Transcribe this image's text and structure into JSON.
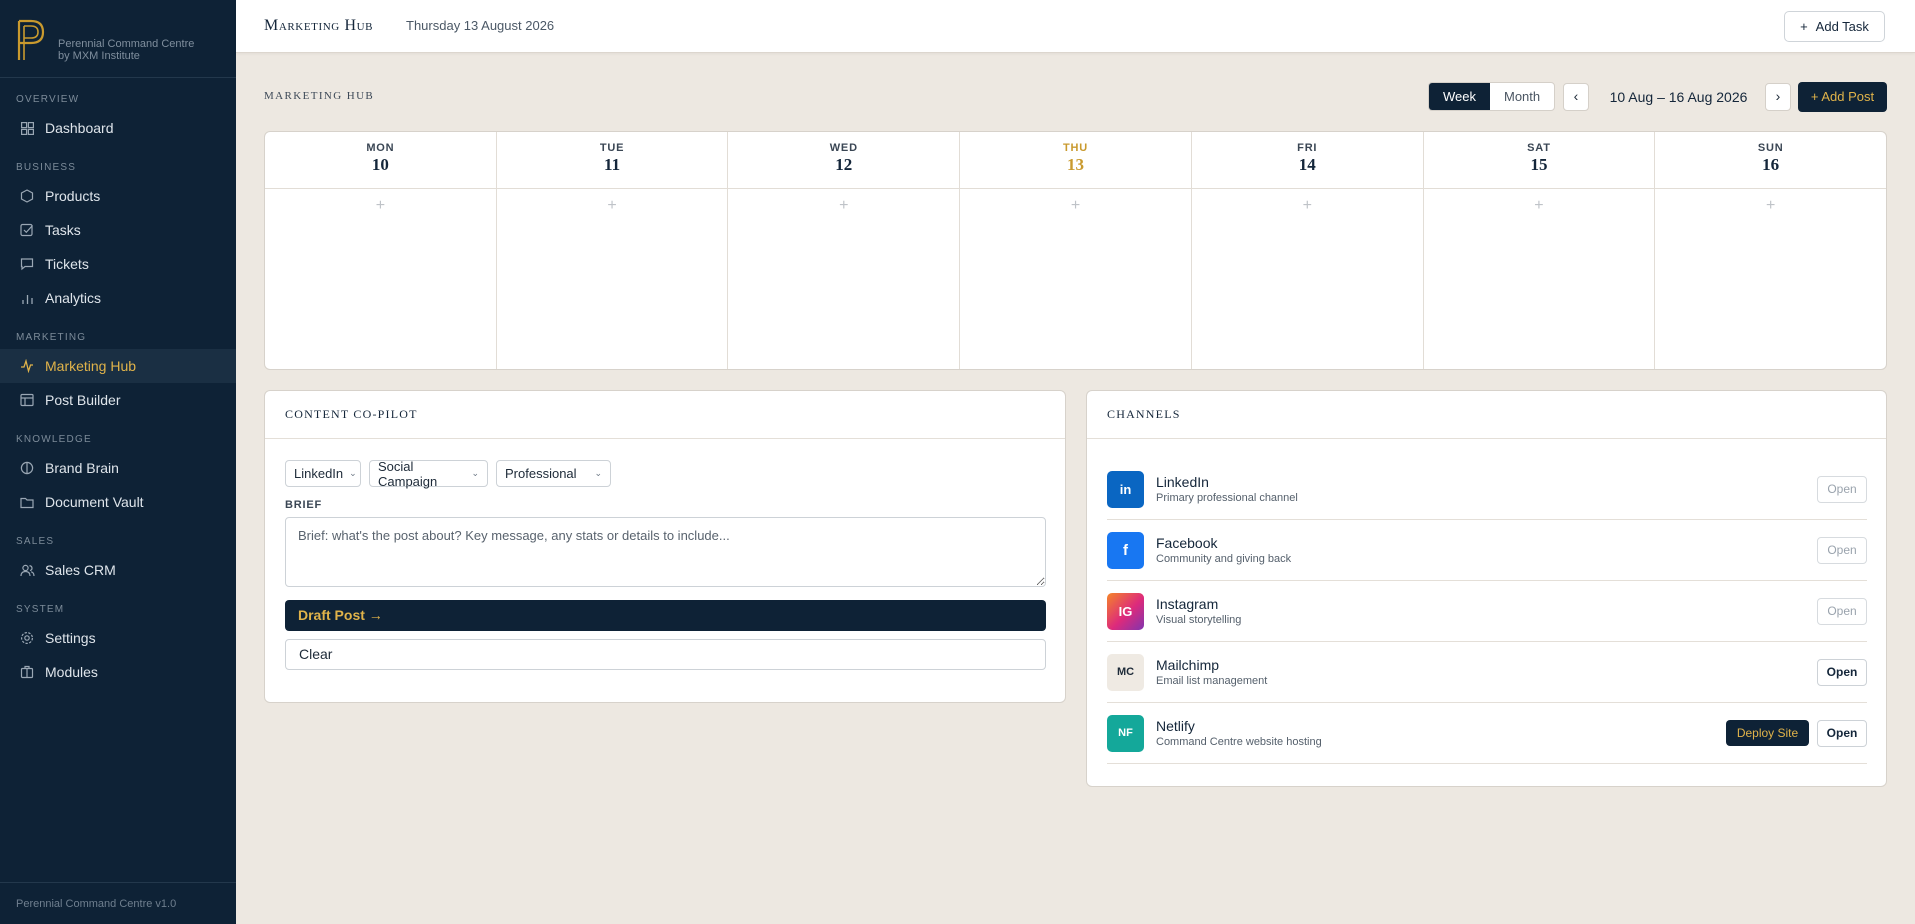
{
  "sidebar": {
    "tagline": "Perennial Command Centre by MXM Institute",
    "sections": {
      "overview": "OVERVIEW",
      "business": "BUSINESS",
      "marketing": "MARKETING",
      "knowledge": "KNOWLEDGE",
      "sales": "SALES",
      "system": "SYSTEM"
    },
    "items": {
      "dashboard": "Dashboard",
      "products": "Products",
      "tasks": "Tasks",
      "tickets": "Tickets",
      "analytics": "Analytics",
      "marketing_hub": "Marketing Hub",
      "post_builder": "Post Builder",
      "brand_brain": "Brand Brain",
      "document_vault": "Document Vault",
      "sales_crm": "Sales CRM",
      "settings": "Settings",
      "modules": "Modules"
    },
    "footer": "Perennial Command Centre v1.0",
    "accent_color": "#e0b34a",
    "bg_color": "#0e2236"
  },
  "topbar": {
    "title": "Marketing Hub",
    "date": "Thursday 13 August 2026",
    "add_task_label": "Add Task"
  },
  "hub": {
    "label": "MARKETING HUB",
    "views": [
      "Week",
      "Month"
    ],
    "active_view": "Week",
    "prev_label": "‹",
    "next_label": "›",
    "range": "10 Aug – 16 Aug 2026",
    "add_post_label": "+ Add Post"
  },
  "calendar": {
    "days": [
      {
        "name": "MON",
        "num": "10",
        "add": "+"
      },
      {
        "name": "TUE",
        "num": "11",
        "add": "+"
      },
      {
        "name": "WED",
        "num": "12",
        "add": "+"
      },
      {
        "name": "THU",
        "num": "13",
        "add": "+"
      },
      {
        "name": "FRI",
        "num": "14",
        "add": "+"
      },
      {
        "name": "SAT",
        "num": "15",
        "add": "+"
      },
      {
        "name": "SUN",
        "num": "16",
        "add": "+"
      }
    ],
    "today_index": 3
  },
  "copilot": {
    "title": "CONTENT CO-PILOT",
    "platform": "LinkedIn",
    "content_type": "Social Campaign",
    "tone": "Professional",
    "brief_label": "BRIEF",
    "brief_placeholder": "Brief: what's the post about? Key message, any stats or details to include...",
    "brief_value": "",
    "draft_label": "Draft Post →",
    "clear_label": "Clear"
  },
  "channels": {
    "title": "CHANNELS",
    "open_label": "Open",
    "deploy_label": "Deploy Site",
    "items": [
      {
        "abbr": "in",
        "name": "LinkedIn",
        "desc": "Primary professional channel",
        "color": "#0a66c2",
        "enabled": false
      },
      {
        "abbr": "f",
        "name": "Facebook",
        "desc": "Community and giving back",
        "color": "#1877f2",
        "enabled": false
      },
      {
        "abbr": "IG",
        "name": "Instagram",
        "desc": "Visual storytelling",
        "color": "#e1306c",
        "enabled": false
      },
      {
        "abbr": "MC",
        "name": "Mailchimp",
        "desc": "Email list management",
        "color": "#efeae3",
        "enabled": true
      },
      {
        "abbr": "NF",
        "name": "Netlify",
        "desc": "Command Centre website hosting",
        "color": "#14a89a",
        "enabled": true
      }
    ]
  }
}
